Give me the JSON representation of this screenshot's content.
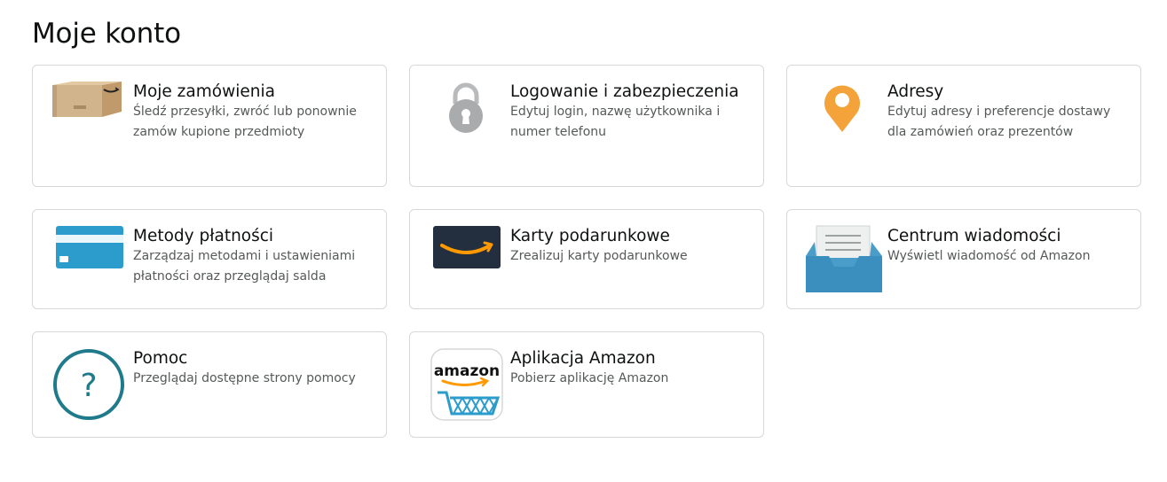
{
  "page": {
    "title": "Moje konto"
  },
  "cards": [
    {
      "id": "orders",
      "title": "Moje zamówienia",
      "description": "Śledź przesyłki, zwróć lub ponownie zamów kupione przedmioty",
      "icon": "package-box-icon"
    },
    {
      "id": "security",
      "title": "Logowanie i zabezpieczenia",
      "description": "Edytuj login, nazwę użytkownika i numer telefonu",
      "icon": "padlock-icon"
    },
    {
      "id": "addresses",
      "title": "Adresy",
      "description": "Edytuj adresy i preferencje dostawy dla zamówień oraz prezentów",
      "icon": "map-pin-icon"
    },
    {
      "id": "payments",
      "title": "Metody płatności",
      "description": "Zarządzaj metodami i ustawieniami płatności oraz przeglądaj salda",
      "icon": "credit-card-icon"
    },
    {
      "id": "giftcards",
      "title": "Karty podarunkowe",
      "description": "Zrealizuj karty podarunkowe",
      "icon": "gift-card-icon"
    },
    {
      "id": "messages",
      "title": "Centrum wiadomości",
      "description": "Wyświetl wiadomość od Amazon",
      "icon": "inbox-tray-icon"
    },
    {
      "id": "help",
      "title": "Pomoc",
      "description": "Przeglądaj dostępne strony pomocy",
      "icon": "question-mark-icon"
    },
    {
      "id": "app",
      "title": "Aplikacja Amazon",
      "description": "Pobierz aplikację Amazon",
      "icon": "amazon-app-icon",
      "icon_text": "amazon"
    }
  ],
  "colors": {
    "card_border": "#d5d9d9",
    "title_text": "#0f1111",
    "description_text": "#565959",
    "pin_orange": "#f3a33a",
    "card_blue": "#2b9ccb",
    "help_teal": "#1f7a8c",
    "gift_card_navy": "#232f3e",
    "amazon_orange": "#ff9900"
  }
}
